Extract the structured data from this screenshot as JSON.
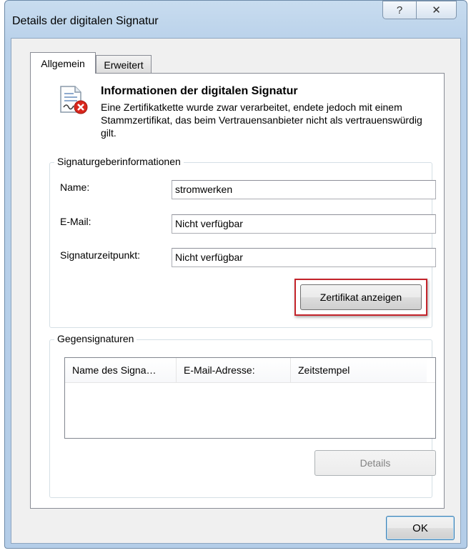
{
  "window": {
    "title": "Details der digitalen Signatur",
    "help_label": "?",
    "close_label": "✕"
  },
  "tabs": [
    {
      "label": "Allgemein",
      "selected": true
    },
    {
      "label": "Erweitert",
      "selected": false
    }
  ],
  "info": {
    "icon": "document-error-icon",
    "title": "Informationen der digitalen Signatur",
    "message": "Eine Zertifikatkette wurde zwar verarbeitet, endete jedoch mit einem Stammzertifikat, das beim Vertrauensanbieter nicht als vertrauenswürdig gilt."
  },
  "signer": {
    "legend": "Signaturgeberinformationen",
    "name_label": "Name:",
    "name_value": "stromwerken",
    "email_label": "E-Mail:",
    "email_value": "Nicht verfügbar",
    "time_label": "Signaturzeitpunkt:",
    "time_value": "Nicht verfügbar",
    "view_cert_label": "Zertifikat anzeigen"
  },
  "countersignatures": {
    "legend": "Gegensignaturen",
    "columns": [
      "Name des Signa…",
      "E-Mail-Adresse:",
      "Zeitstempel"
    ],
    "details_label": "Details"
  },
  "footer": {
    "ok_label": "OK"
  },
  "colors": {
    "highlight": "#c4242b",
    "error_icon": "#d9261c"
  }
}
